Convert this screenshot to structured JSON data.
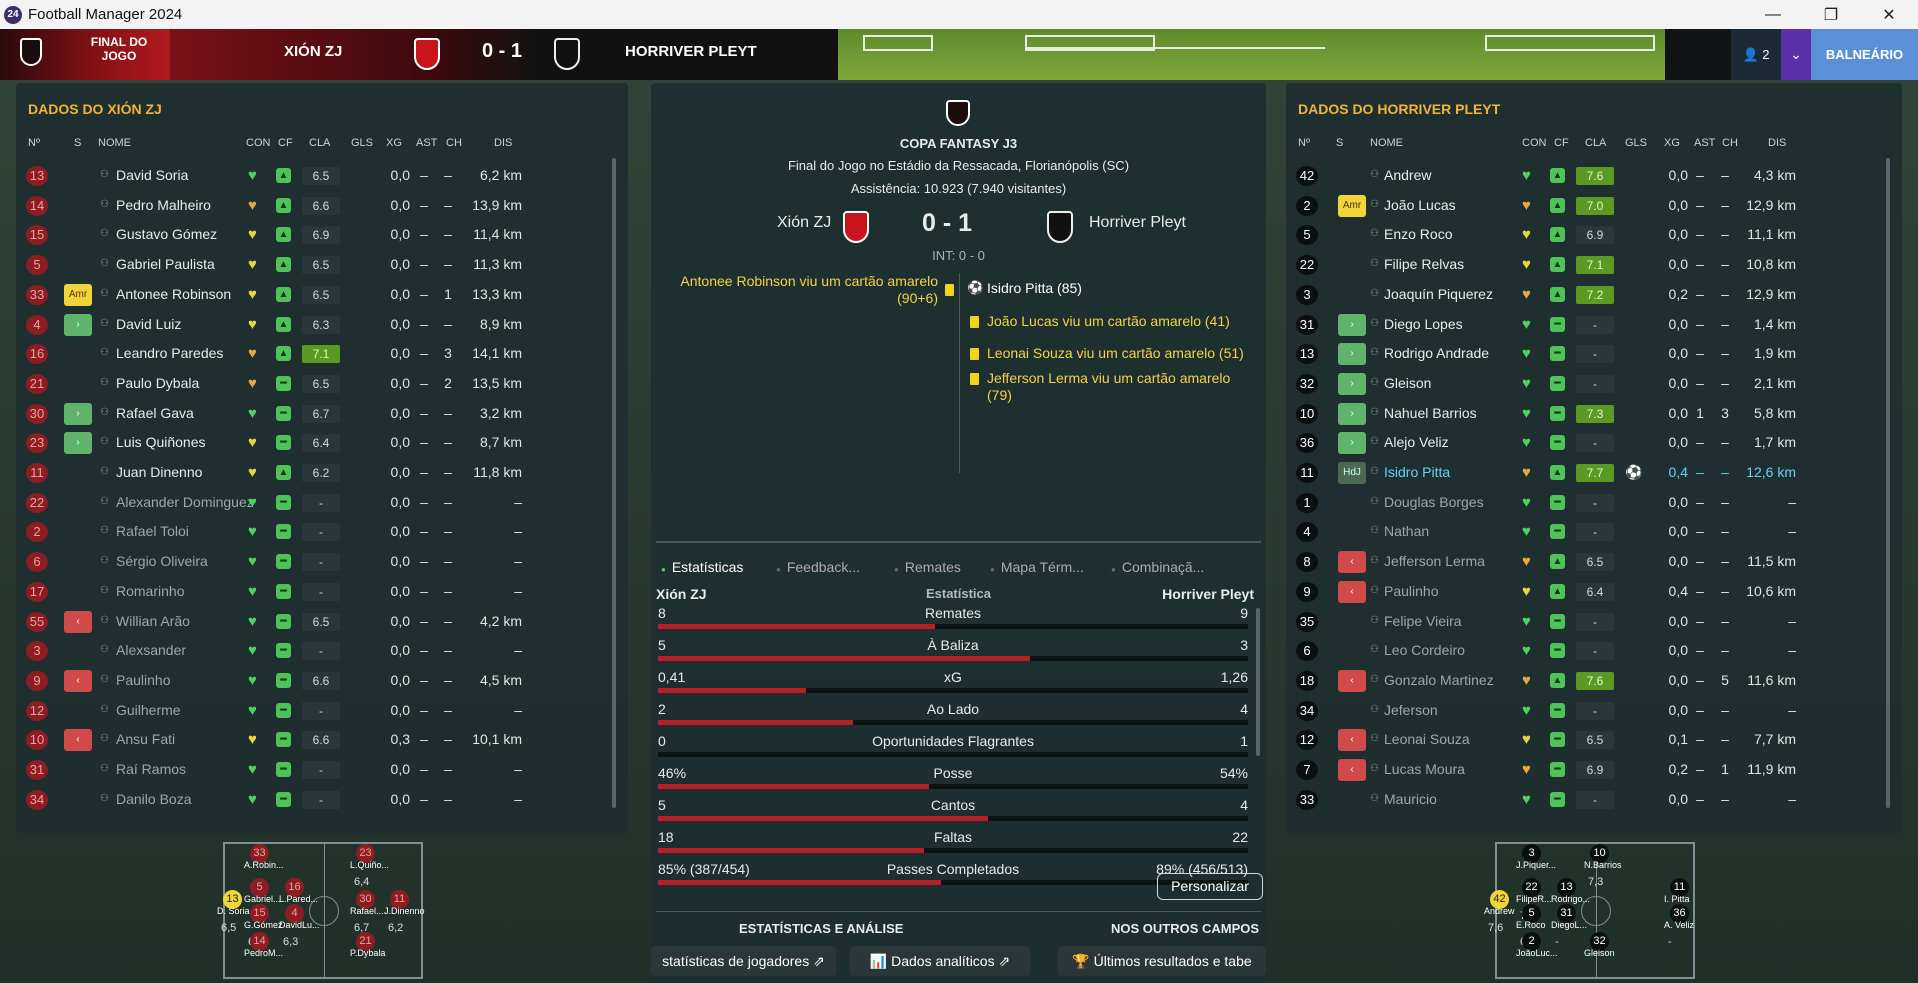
{
  "window": {
    "title": "Football Manager 2024",
    "icon": "24"
  },
  "header": {
    "status": "FINAL DO JOGO",
    "home": "XIÓN ZJ",
    "away": "HORRIVER PLEYT",
    "score": "0 - 1",
    "users": "2",
    "button": "BALNEÁRIO"
  },
  "home_panel": {
    "title": "DADOS DO XIÓN ZJ"
  },
  "away_panel": {
    "title": "DADOS DO HORRIVER PLEYT"
  },
  "columns": {
    "no": "Nº",
    "s": "S",
    "name": "NOME",
    "con": "CON",
    "cf": "CF",
    "cla": "CLA",
    "gls": "GLS",
    "xg": "XG",
    "ast": "AST",
    "ch": "CH",
    "dis": "DIS"
  },
  "home_players": [
    {
      "n": "13",
      "s": "",
      "name": "David Soria",
      "cla": "6.5",
      "xg": "0,0",
      "ast": "–",
      "ch": "–",
      "dis": "6,2 km",
      "active": true,
      "heart": "green",
      "cf": "up"
    },
    {
      "n": "14",
      "s": "",
      "name": "Pedro Malheiro",
      "cla": "6.6",
      "xg": "0,0",
      "ast": "–",
      "ch": "–",
      "dis": "13,9 km",
      "active": true,
      "heart": "orange",
      "cf": "up"
    },
    {
      "n": "15",
      "s": "",
      "name": "Gustavo Gómez",
      "cla": "6.9",
      "xg": "0,0",
      "ast": "–",
      "ch": "–",
      "dis": "11,4 km",
      "active": true,
      "heart": "yellow",
      "cf": "up"
    },
    {
      "n": "5",
      "s": "",
      "name": "Gabriel Paulista",
      "cla": "6.5",
      "xg": "0,0",
      "ast": "–",
      "ch": "–",
      "dis": "11,3 km",
      "active": true,
      "heart": "yellow",
      "cf": "up"
    },
    {
      "n": "33",
      "s": "Amr",
      "name": "Antonee Robinson",
      "cla": "6.5",
      "xg": "0,0",
      "ast": "–",
      "ch": "1",
      "dis": "13,3 km",
      "active": true,
      "heart": "yellow",
      "cf": "up"
    },
    {
      "n": "4",
      "s": "in",
      "name": "David Luiz",
      "cla": "6.3",
      "xg": "0,0",
      "ast": "–",
      "ch": "–",
      "dis": "8,9 km",
      "active": true,
      "heart": "yellow",
      "cf": "up"
    },
    {
      "n": "16",
      "s": "",
      "name": "Leandro Paredes",
      "cla": "7.1",
      "xg": "0,0",
      "ast": "–",
      "ch": "3",
      "dis": "14,1 km",
      "active": true,
      "heart": "orange",
      "cf": "up",
      "hi": true
    },
    {
      "n": "21",
      "s": "",
      "name": "Paulo Dybala",
      "cla": "6.5",
      "xg": "0,0",
      "ast": "–",
      "ch": "2",
      "dis": "13,5 km",
      "active": true,
      "heart": "orange",
      "cf": "mid"
    },
    {
      "n": "30",
      "s": "in",
      "name": "Rafael Gava",
      "cla": "6.7",
      "xg": "0,0",
      "ast": "–",
      "ch": "–",
      "dis": "3,2 km",
      "active": true,
      "heart": "green",
      "cf": "mid"
    },
    {
      "n": "23",
      "s": "in",
      "name": "Luis Quiñones",
      "cla": "6.4",
      "xg": "0,0",
      "ast": "–",
      "ch": "–",
      "dis": "8,7 km",
      "active": true,
      "heart": "yellow",
      "cf": "mid"
    },
    {
      "n": "11",
      "s": "",
      "name": "Juan Dinenno",
      "cla": "6.2",
      "xg": "0,0",
      "ast": "–",
      "ch": "–",
      "dis": "11,8 km",
      "active": true,
      "heart": "yellow",
      "cf": "up"
    },
    {
      "n": "22",
      "s": "",
      "name": "Alexander Dominguez",
      "cla": "-",
      "xg": "0,0",
      "ast": "–",
      "ch": "–",
      "dis": "–",
      "active": false,
      "heart": "green",
      "cf": "mid"
    },
    {
      "n": "2",
      "s": "",
      "name": "Rafael Toloi",
      "cla": "-",
      "xg": "0,0",
      "ast": "–",
      "ch": "–",
      "dis": "–",
      "active": false,
      "heart": "green",
      "cf": "mid"
    },
    {
      "n": "6",
      "s": "",
      "name": "Sérgio Oliveira",
      "cla": "-",
      "xg": "0,0",
      "ast": "–",
      "ch": "–",
      "dis": "–",
      "active": false,
      "heart": "green",
      "cf": "mid"
    },
    {
      "n": "17",
      "s": "",
      "name": "Romarinho",
      "cla": "-",
      "xg": "0,0",
      "ast": "–",
      "ch": "–",
      "dis": "–",
      "active": false,
      "heart": "green",
      "cf": "mid"
    },
    {
      "n": "55",
      "s": "out",
      "name": "Willian Arão",
      "cla": "6.5",
      "xg": "0,0",
      "ast": "–",
      "ch": "–",
      "dis": "4,2 km",
      "active": false,
      "heart": "green",
      "cf": "mid"
    },
    {
      "n": "3",
      "s": "",
      "name": "Alexsander",
      "cla": "-",
      "xg": "0,0",
      "ast": "–",
      "ch": "–",
      "dis": "–",
      "active": false,
      "heart": "green",
      "cf": "mid"
    },
    {
      "n": "9",
      "s": "out",
      "name": "Paulinho",
      "cla": "6.6",
      "xg": "0,0",
      "ast": "–",
      "ch": "–",
      "dis": "4,5 km",
      "active": false,
      "heart": "green",
      "cf": "mid"
    },
    {
      "n": "12",
      "s": "",
      "name": "Guilherme",
      "cla": "-",
      "xg": "0,0",
      "ast": "–",
      "ch": "–",
      "dis": "–",
      "active": false,
      "heart": "green",
      "cf": "mid"
    },
    {
      "n": "10",
      "s": "out",
      "name": "Ansu Fati",
      "cla": "6.6",
      "xg": "0,3",
      "ast": "–",
      "ch": "–",
      "dis": "10,1 km",
      "active": false,
      "heart": "yellow",
      "cf": "mid"
    },
    {
      "n": "31",
      "s": "",
      "name": "Raí Ramos",
      "cla": "-",
      "xg": "0,0",
      "ast": "–",
      "ch": "–",
      "dis": "–",
      "active": false,
      "heart": "green",
      "cf": "mid"
    },
    {
      "n": "34",
      "s": "",
      "name": "Danilo Boza",
      "cla": "-",
      "xg": "0,0",
      "ast": "–",
      "ch": "–",
      "dis": "–",
      "active": false,
      "heart": "green",
      "cf": "mid"
    }
  ],
  "away_players": [
    {
      "n": "42",
      "s": "",
      "name": "Andrew",
      "cla": "7.6",
      "xg": "0,0",
      "ast": "–",
      "ch": "–",
      "dis": "4,3 km",
      "active": true,
      "heart": "green",
      "cf": "up",
      "hi": true
    },
    {
      "n": "2",
      "s": "Amr",
      "name": "João Lucas",
      "cla": "7.0",
      "xg": "0,0",
      "ast": "–",
      "ch": "–",
      "dis": "12,9 km",
      "active": true,
      "heart": "orange",
      "cf": "up",
      "hi": true
    },
    {
      "n": "5",
      "s": "",
      "name": "Enzo Roco",
      "cla": "6.9",
      "xg": "0,0",
      "ast": "–",
      "ch": "–",
      "dis": "11,1 km",
      "active": true,
      "heart": "yellow",
      "cf": "up"
    },
    {
      "n": "22",
      "s": "",
      "name": "Filipe Relvas",
      "cla": "7.1",
      "xg": "0,0",
      "ast": "–",
      "ch": "–",
      "dis": "10,8 km",
      "active": true,
      "heart": "yellow",
      "cf": "up",
      "hi": true
    },
    {
      "n": "3",
      "s": "",
      "name": "Joaquín Piquerez",
      "cla": "7.2",
      "xg": "0,2",
      "ast": "–",
      "ch": "–",
      "dis": "12,9 km",
      "active": true,
      "heart": "orange",
      "cf": "up",
      "hi": true
    },
    {
      "n": "31",
      "s": "in",
      "name": "Diego Lopes",
      "cla": "-",
      "xg": "0,0",
      "ast": "–",
      "ch": "–",
      "dis": "1,4 km",
      "active": true,
      "heart": "green",
      "cf": "mid"
    },
    {
      "n": "13",
      "s": "in",
      "name": "Rodrigo Andrade",
      "cla": "-",
      "xg": "0,0",
      "ast": "–",
      "ch": "–",
      "dis": "1,9 km",
      "active": true,
      "heart": "green",
      "cf": "mid"
    },
    {
      "n": "32",
      "s": "in",
      "name": "Gleison",
      "cla": "-",
      "xg": "0,0",
      "ast": "–",
      "ch": "–",
      "dis": "2,1 km",
      "active": true,
      "heart": "green",
      "cf": "mid"
    },
    {
      "n": "10",
      "s": "in",
      "name": "Nahuel Barrios",
      "cla": "7.3",
      "xg": "0,0",
      "ast": "1",
      "ch": "3",
      "dis": "5,8 km",
      "active": true,
      "heart": "green",
      "cf": "mid",
      "hi": true
    },
    {
      "n": "36",
      "s": "in",
      "name": "Alejo Veliz",
      "cla": "-",
      "xg": "0,0",
      "ast": "–",
      "ch": "–",
      "dis": "1,7 km",
      "active": true,
      "heart": "green",
      "cf": "mid"
    },
    {
      "n": "11",
      "s": "HdJ",
      "name": "Isidro Pitta",
      "cla": "7.7",
      "gls": "⚽",
      "xg": "0,4",
      "ast": "–",
      "ch": "–",
      "dis": "12,6 km",
      "active": true,
      "heart": "orange",
      "cf": "up",
      "hi": true,
      "star": true
    },
    {
      "n": "1",
      "s": "",
      "name": "Douglas Borges",
      "cla": "-",
      "xg": "0,0",
      "ast": "–",
      "ch": "–",
      "dis": "–",
      "active": false,
      "heart": "green",
      "cf": "mid"
    },
    {
      "n": "4",
      "s": "",
      "name": "Nathan",
      "cla": "-",
      "xg": "0,0",
      "ast": "–",
      "ch": "–",
      "dis": "–",
      "active": false,
      "heart": "green",
      "cf": "mid"
    },
    {
      "n": "8",
      "s": "out",
      "name": "Jefferson Lerma",
      "cla": "6.5",
      "xg": "0,0",
      "ast": "–",
      "ch": "–",
      "dis": "11,5 km",
      "active": false,
      "heart": "orange",
      "cf": "up"
    },
    {
      "n": "9",
      "s": "out",
      "name": "Paulinho",
      "cla": "6.4",
      "xg": "0,4",
      "ast": "–",
      "ch": "–",
      "dis": "10,6 km",
      "active": false,
      "heart": "yellow",
      "cf": "up"
    },
    {
      "n": "35",
      "s": "",
      "name": "Felipe Vieira",
      "cla": "-",
      "xg": "0,0",
      "ast": "–",
      "ch": "–",
      "dis": "–",
      "active": false,
      "heart": "green",
      "cf": "mid"
    },
    {
      "n": "6",
      "s": "",
      "name": "Leo Cordeiro",
      "cla": "-",
      "xg": "0,0",
      "ast": "–",
      "ch": "–",
      "dis": "–",
      "active": false,
      "heart": "green",
      "cf": "mid"
    },
    {
      "n": "18",
      "s": "out",
      "name": "Gonzalo Martinez",
      "cla": "7.6",
      "xg": "0,0",
      "ast": "–",
      "ch": "5",
      "dis": "11,6 km",
      "active": false,
      "heart": "orange",
      "cf": "up",
      "hi": true
    },
    {
      "n": "34",
      "s": "",
      "name": "Jeferson",
      "cla": "-",
      "xg": "0,0",
      "ast": "–",
      "ch": "–",
      "dis": "–",
      "active": false,
      "heart": "green",
      "cf": "mid"
    },
    {
      "n": "12",
      "s": "out",
      "name": "Leonai Souza",
      "cla": "6.5",
      "xg": "0,1",
      "ast": "–",
      "ch": "–",
      "dis": "7,7 km",
      "active": false,
      "heart": "yellow",
      "cf": "mid"
    },
    {
      "n": "7",
      "s": "out",
      "name": "Lucas Moura",
      "cla": "6.9",
      "xg": "0,2",
      "ast": "–",
      "ch": "1",
      "dis": "11,9 km",
      "active": false,
      "heart": "orange",
      "cf": "mid"
    },
    {
      "n": "33",
      "s": "",
      "name": "Mauricio",
      "cla": "-",
      "xg": "0,0",
      "ast": "–",
      "ch": "–",
      "dis": "–",
      "active": false,
      "heart": "green",
      "cf": "mid"
    }
  ],
  "match": {
    "competition": "COPA FANTASY  J3",
    "venue": "Final do Jogo no Estádio da Ressacada, Florianópolis (SC)",
    "attendance": "Assistência: 10.923 (7.940 visitantes)",
    "home": "Xión ZJ",
    "away": "Horriver Pleyt",
    "score": "0 - 1",
    "ht": "INT: 0 - 0",
    "home_events": [
      {
        "text": "Antonee Robinson viu um cartão amarelo (90+6)",
        "type": "yellow"
      }
    ],
    "away_events": [
      {
        "text": "Isidro Pitta (85)",
        "type": "goal"
      },
      {
        "text": "João Lucas viu um cartão amarelo (41)",
        "type": "yellow"
      },
      {
        "text": "Leonai Souza viu um cartão amarelo (51)",
        "type": "yellow"
      },
      {
        "text": "Jefferson Lerma viu um cartão amarelo (79)",
        "type": "yellow"
      }
    ]
  },
  "tabs": [
    "Estatísticas",
    "Feedback...",
    "Remates",
    "Mapa Térm...",
    "Combinaçã..."
  ],
  "stats_header": {
    "home": "Xión ZJ",
    "mid": "Estatística",
    "away": "Horriver Pleyt"
  },
  "stats": [
    {
      "label": "Remates",
      "h": "8",
      "a": "9",
      "share": 0.47
    },
    {
      "label": "À Baliza",
      "h": "5",
      "a": "3",
      "share": 0.63
    },
    {
      "label": "xG",
      "h": "0,41",
      "a": "1,26",
      "share": 0.25
    },
    {
      "label": "Ao Lado",
      "h": "2",
      "a": "4",
      "share": 0.33
    },
    {
      "label": "Oportunidades Flagrantes",
      "h": "0",
      "a": "1",
      "share": 0
    },
    {
      "label": "Posse",
      "h": "46%",
      "a": "54%",
      "share": 0.46
    },
    {
      "label": "Cantos",
      "h": "5",
      "a": "4",
      "share": 0.56
    },
    {
      "label": "Faltas",
      "h": "18",
      "a": "22",
      "share": 0.45
    },
    {
      "label": "Passes Completados",
      "h": "85% (387/454)",
      "a": "89% (456/513)",
      "share": 0.48
    }
  ],
  "buttons": {
    "customize": "Personalizar",
    "section_left": "ESTATÍSTICAS E ANÁLISE",
    "section_right": "NOS OUTROS CAMPOS",
    "player_stats": "statísticas de jogadores",
    "analytics": "Dados analíticos",
    "results": "Últimos resultados e tabe"
  },
  "home_formation": [
    {
      "n": "13",
      "label": "D. Soria",
      "rating": "6,5"
    },
    {
      "n": "33",
      "label": "A.Robin..."
    },
    {
      "n": "5",
      "label": "Gabriel..."
    },
    {
      "n": "15",
      "label": "G.Gómez",
      "rating": "6,9"
    },
    {
      "n": "16",
      "label": "L.Pared..."
    },
    {
      "n": "4",
      "label": "DavidLu...",
      "rating": "6,3"
    },
    {
      "n": "23",
      "label": "L.Quiño...",
      "rating": "6,4"
    },
    {
      "n": "30",
      "label": "Rafael...",
      "rating": "6,7"
    },
    {
      "n": "11",
      "label": "J.Dinenno",
      "rating": "6,2"
    },
    {
      "n": "21",
      "label": "P.Dybala"
    },
    {
      "n": "14",
      "label": "PedroM..."
    }
  ],
  "away_formation": [
    {
      "n": "42",
      "label": "Andrew",
      "rating": "7,6"
    },
    {
      "n": "3",
      "label": "J.Piquer..."
    },
    {
      "n": "22",
      "label": "FilipeR...",
      "rating": "7,1"
    },
    {
      "n": "5",
      "label": "E.Roco",
      "rating": "6,9"
    },
    {
      "n": "2",
      "label": "JoãoLuc..."
    },
    {
      "n": "13",
      "label": "Rodrigo..."
    },
    {
      "n": "31",
      "label": "DiegoL...",
      "rating": "-"
    },
    {
      "n": "10",
      "label": "N.Barrios",
      "rating": "7,3"
    },
    {
      "n": "32",
      "label": "Gleison"
    },
    {
      "n": "11",
      "label": "I. Pitta"
    },
    {
      "n": "36",
      "label": "A. Veliz",
      "rating": "-"
    }
  ],
  "colors": {
    "accent": "#f0b43a",
    "red": "#b81e25",
    "home": "#c8141c",
    "away": "#111111"
  }
}
